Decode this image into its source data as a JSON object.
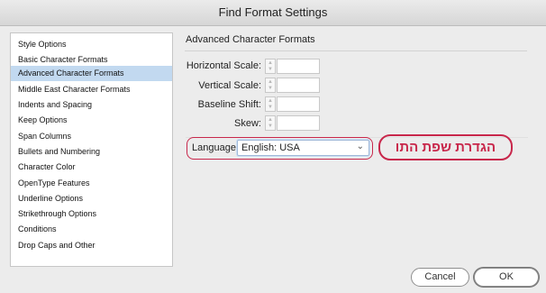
{
  "window": {
    "title": "Find Format Settings"
  },
  "sidebar": {
    "items": [
      {
        "label": "Style Options",
        "selected": false
      },
      {
        "label": "Basic Character Formats",
        "selected": false
      },
      {
        "label": "Advanced Character Formats",
        "selected": true
      },
      {
        "label": "Middle East Character Formats",
        "selected": false
      },
      {
        "label": "Indents and Spacing",
        "selected": false
      },
      {
        "label": "Keep Options",
        "selected": false
      },
      {
        "label": "Span Columns",
        "selected": false
      },
      {
        "label": "Bullets and Numbering",
        "selected": false
      },
      {
        "label": "Character Color",
        "selected": false
      },
      {
        "label": "OpenType Features",
        "selected": false
      },
      {
        "label": "Underline Options",
        "selected": false
      },
      {
        "label": "Strikethrough Options",
        "selected": false
      },
      {
        "label": "Conditions",
        "selected": false
      },
      {
        "label": "Drop Caps and Other",
        "selected": false
      }
    ]
  },
  "main": {
    "title": "Advanced Character Formats",
    "fields": [
      {
        "label": "Horizontal Scale:",
        "value": ""
      },
      {
        "label": "Vertical Scale:",
        "value": ""
      },
      {
        "label": "Baseline Shift:",
        "value": ""
      },
      {
        "label": "Skew:",
        "value": ""
      }
    ],
    "language": {
      "label": "Language:",
      "value": "English: USA"
    }
  },
  "annotation": {
    "text": "הגדרת שפת התו",
    "color": "#c8274b"
  },
  "buttons": {
    "cancel": "Cancel",
    "ok": "OK"
  },
  "colors": {
    "selection": "#c2d9f0",
    "annotation": "#c8274b"
  }
}
